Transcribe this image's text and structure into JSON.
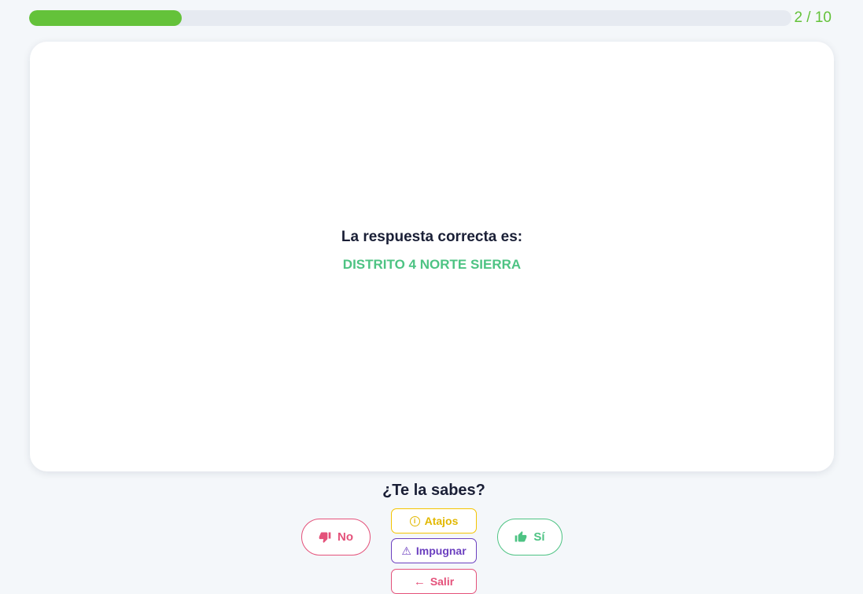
{
  "progress": {
    "text": "2 / 10",
    "fraction": 0.2
  },
  "card": {
    "label": "La respuesta correcta es:",
    "answer": "DISTRITO 4 NORTE SIERRA"
  },
  "prompt": "¿Te la sabes?",
  "actions": {
    "no_label": "No",
    "yes_label": "Sí",
    "atajos_label": "Atajos",
    "impugnar_label": "Impugnar",
    "salir_label": "Salir"
  },
  "icons": {
    "no": "thumbs-down-icon",
    "yes": "thumbs-up-icon",
    "atajos": "info-icon",
    "impugnar": "warning-icon",
    "salir": "arrow-left-icon"
  },
  "colors": {
    "progress": "#64c23a",
    "answer": "#4dc383",
    "no": "#e4517a",
    "yes": "#4dc383",
    "atajos": "#f4c400",
    "impugnar": "#6b3fbf",
    "salir": "#e4517a"
  }
}
